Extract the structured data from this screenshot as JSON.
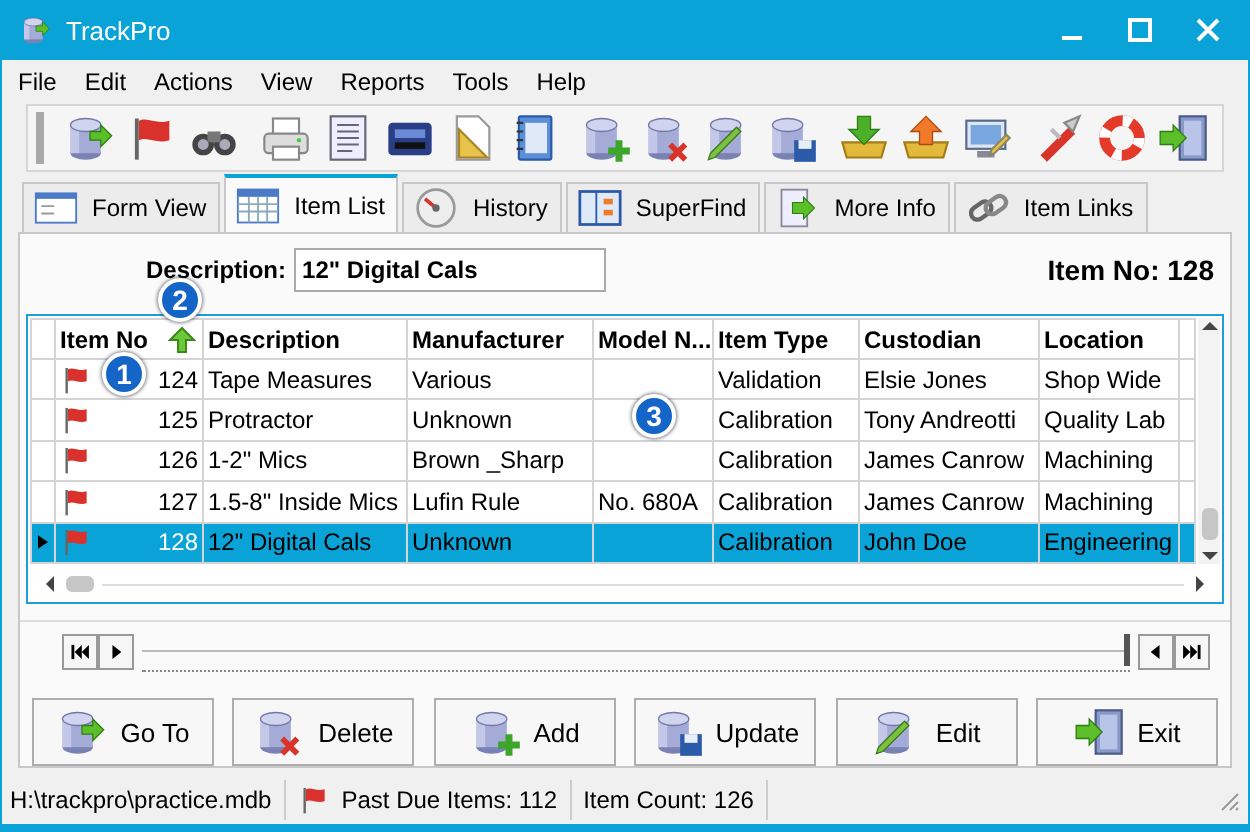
{
  "window": {
    "title": "TrackPro"
  },
  "menu": [
    "File",
    "Edit",
    "Actions",
    "View",
    "Reports",
    "Tools",
    "Help"
  ],
  "tabs": [
    {
      "label": "Form View",
      "selected": false
    },
    {
      "label": "Item List",
      "selected": true
    },
    {
      "label": "History",
      "selected": false
    },
    {
      "label": "SuperFind",
      "selected": false
    },
    {
      "label": "More Info",
      "selected": false
    },
    {
      "label": "Item Links",
      "selected": false
    }
  ],
  "description": {
    "label": "Description:",
    "value": "12\" Digital Cals"
  },
  "item_no": "Item No: 128",
  "table": {
    "columns": [
      {
        "label": "Item No",
        "sorted": true
      },
      {
        "label": "Description",
        "sorted": false
      },
      {
        "label": "Manufacturer",
        "sorted": false
      },
      {
        "label": "Model N...",
        "sorted": false
      },
      {
        "label": "Item Type",
        "sorted": false
      },
      {
        "label": "Custodian",
        "sorted": false
      },
      {
        "label": "Location",
        "sorted": false
      }
    ],
    "rows": [
      {
        "past_due": true,
        "selected": false,
        "cells": [
          "124",
          "Tape Measures",
          "Various",
          "",
          "Validation",
          "Elsie Jones",
          "Shop Wide"
        ]
      },
      {
        "past_due": true,
        "selected": false,
        "cells": [
          "125",
          "Protractor",
          "Unknown",
          "",
          "Calibration",
          "Tony Andreotti",
          "Quality Lab"
        ]
      },
      {
        "past_due": true,
        "selected": false,
        "cells": [
          "126",
          "1-2\" Mics",
          "Brown _Sharp",
          "",
          "Calibration",
          "James Canrow",
          "Machining"
        ]
      },
      {
        "past_due": true,
        "selected": false,
        "cells": [
          "127",
          "1.5-8\" Inside Mics",
          "Lufin Rule",
          "No. 680A",
          "Calibration",
          "James Canrow",
          "Machining"
        ]
      },
      {
        "past_due": true,
        "selected": true,
        "cells": [
          "128",
          "12\" Digital Cals",
          "Unknown",
          "",
          "Calibration",
          "John Doe",
          "Engineering"
        ]
      }
    ]
  },
  "callouts": [
    {
      "label": "1"
    },
    {
      "label": "2"
    },
    {
      "label": "3"
    }
  ],
  "navigator": {
    "level": 1
  },
  "buttons": [
    "Go To",
    "Delete",
    "Add",
    "Update",
    "Edit",
    "Exit"
  ],
  "status_bar": {
    "path": "H:\\trackpro\\practice.mdb",
    "past_due": "Past Due Items: 112",
    "count": "Item Count: 126"
  }
}
